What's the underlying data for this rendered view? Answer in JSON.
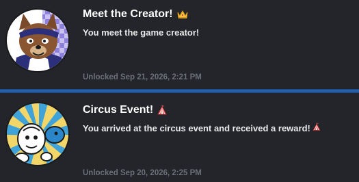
{
  "achievements": [
    {
      "title": "Meet the Creator!",
      "title_icon": "crown-icon",
      "description": "You meet the game creator!",
      "unlocked": "Unlocked Sep 21, 2026, 2:21 PM",
      "avatar": "creator-avatar",
      "accent": "#f5c542"
    },
    {
      "title": "Circus Event!",
      "title_icon": "circus-tent-icon",
      "description": "You arrived at the circus event and received a reward!",
      "description_icon": "circus-tent-icon",
      "unlocked": "Unlocked Sep 20, 2026, 2:25 PM",
      "avatar": "circus-avatar",
      "accent": "#e04545"
    }
  ]
}
